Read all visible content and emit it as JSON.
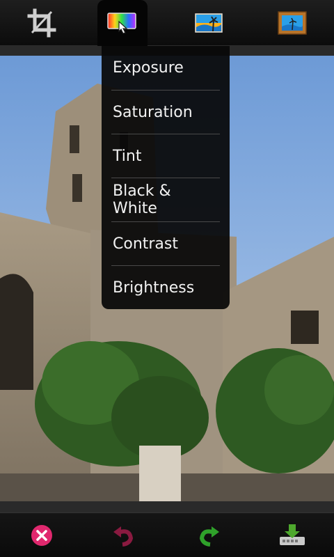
{
  "toolbar": {
    "tools": [
      {
        "icon": "crop-icon"
      },
      {
        "icon": "color-adjust-icon",
        "active": true
      },
      {
        "icon": "scene-icon"
      },
      {
        "icon": "frame-icon"
      }
    ]
  },
  "color_menu": {
    "items": [
      {
        "label": "Exposure"
      },
      {
        "label": "Saturation"
      },
      {
        "label": "Tint"
      },
      {
        "label": "Black & White"
      },
      {
        "label": "Contrast"
      },
      {
        "label": "Brightness"
      }
    ]
  },
  "bottom_bar": {
    "buttons": [
      {
        "icon": "cancel-icon",
        "color": "#e0286e"
      },
      {
        "icon": "undo-icon",
        "color": "#8a1a40"
      },
      {
        "icon": "redo-icon",
        "color": "#2fa12a"
      },
      {
        "icon": "save-icon",
        "color": "#4ea82d"
      }
    ]
  },
  "colors": {
    "toolbar_bg": "#141414",
    "menu_bg": "#080808",
    "menu_text": "#f2f2f2",
    "divider": "#4a4a4a"
  }
}
